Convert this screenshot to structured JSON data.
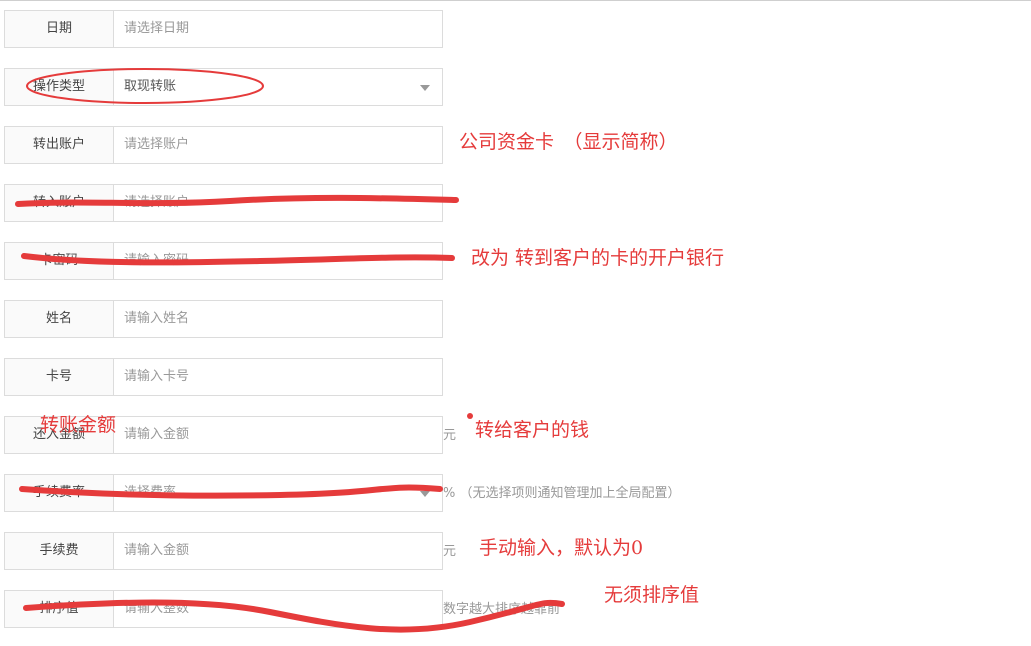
{
  "form": {
    "rows": [
      {
        "label": "日期",
        "placeholder": "请选择日期"
      },
      {
        "label": "操作类型",
        "value": "取现转账"
      },
      {
        "label": "转出账户",
        "placeholder": "请选择账户"
      },
      {
        "label": "转入账户",
        "placeholder": "请选择账户"
      },
      {
        "label": "卡密码",
        "placeholder": "请输入密码"
      },
      {
        "label": "姓名",
        "placeholder": "请输入姓名"
      },
      {
        "label": "卡号",
        "placeholder": "请输入卡号"
      },
      {
        "label": "还入金额",
        "placeholder": "请输入金额",
        "suffix": "元"
      },
      {
        "label": "手续费率",
        "placeholder": "选择费率",
        "suffix": "% （无选择项则通知管理加上全局配置）"
      },
      {
        "label": "手续费",
        "placeholder": "请输入金额",
        "suffix": "元"
      },
      {
        "label": "排序值",
        "placeholder": "请输入整数",
        "suffix": "数字越大排序越靠前"
      }
    ]
  },
  "annotations": {
    "transfer_out": "公司资金卡　（显示简称）",
    "card_password": "改为 转到客户的卡的开户银行",
    "amount_label": "转账金额",
    "amount_note": "转给客户的钱",
    "fee_note": "手动输入，默认为0",
    "sort_note": "无须排序值"
  },
  "colors": {
    "annotation": "#e53b3b",
    "border": "#dcdcdc",
    "label_bg": "#fafafa"
  },
  "icons": {
    "select_arrow": "chevron-down-icon"
  }
}
